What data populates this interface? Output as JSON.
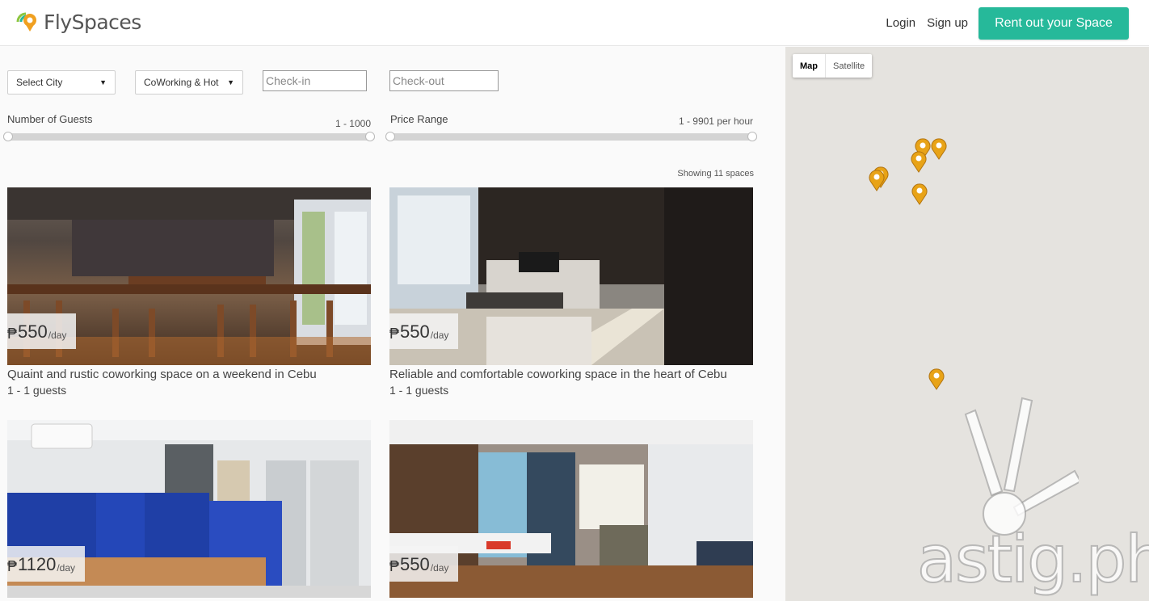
{
  "header": {
    "brand": "FlySpaces",
    "login_label": "Login",
    "signup_label": "Sign up",
    "rent_button_label": "Rent out your Space",
    "accent_color": "#26b99a"
  },
  "filters": {
    "city_select": "Select City",
    "type_select": "CoWorking & Hot",
    "checkin_placeholder": "Check-in",
    "checkout_placeholder": "Check-out",
    "guests": {
      "label": "Number of Guests",
      "value": "1 - 1000"
    },
    "price": {
      "label": "Price Range",
      "value": "1 - 9901 per hour"
    }
  },
  "results": {
    "count_text": "Showing 11 spaces",
    "listings": [
      {
        "currency": "₱",
        "price": "550",
        "unit": "/day",
        "title": "Quaint and rustic coworking space on a weekend in Cebu",
        "guests": "1 - 1 guests"
      },
      {
        "currency": "₱",
        "price": "550",
        "unit": "/day",
        "title": "Reliable and comfortable coworking space in the heart of Cebu",
        "guests": "1 - 1 guests"
      },
      {
        "currency": "₱",
        "price": "1120",
        "unit": "/day",
        "title": "",
        "guests": ""
      },
      {
        "currency": "₱",
        "price": "550",
        "unit": "/day",
        "title": "",
        "guests": ""
      }
    ]
  },
  "map": {
    "map_label": "Map",
    "satellite_label": "Satellite",
    "pin_color": "#e8a317"
  },
  "watermark": {
    "text": "astig.ph"
  }
}
